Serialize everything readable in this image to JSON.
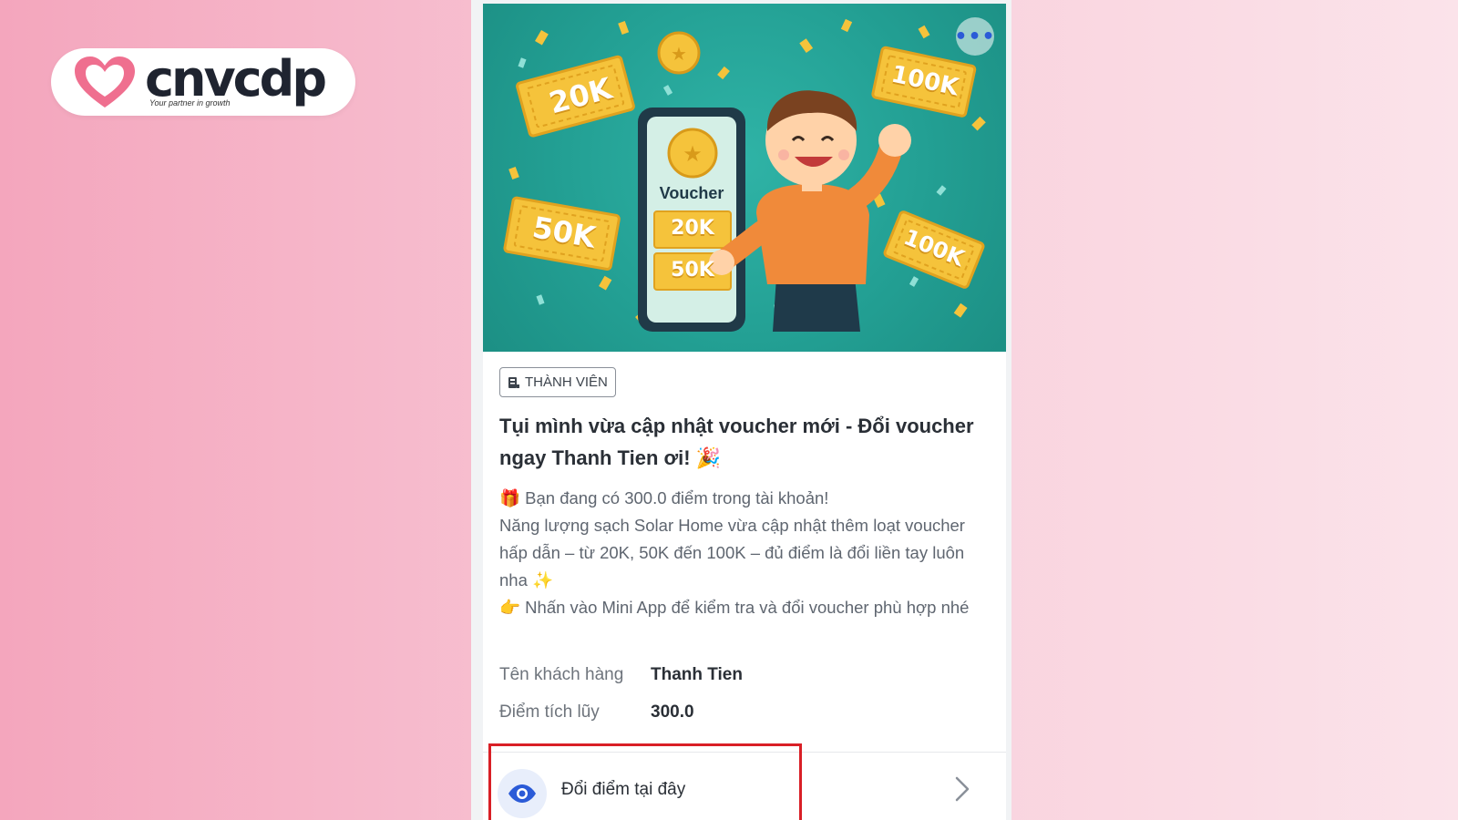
{
  "logo": {
    "wordmark": "cnvcdp",
    "tagline": "Your partner in growth"
  },
  "hero": {
    "tickets": [
      "20K",
      "50K",
      "100K",
      "100K"
    ],
    "phone_title": "Voucher",
    "phone_tickets": [
      "20K",
      "50K"
    ],
    "more_icon": "more-dots-icon"
  },
  "card": {
    "badge": "THÀNH VIÊN",
    "title": "Tụi mình vừa cập nhật voucher mới - Đổi voucher ngay Thanh Tien ơi! 🎉",
    "body_lines": [
      "🎁 Bạn đang có 300.0 điểm trong tài khoản!",
      "Năng lượng sạch Solar Home vừa cập nhật thêm loạt voucher hấp dẫn – từ 20K, 50K đến 100K – đủ điểm là đổi liền tay luôn nha ✨",
      "👉 Nhấn vào Mini App để kiểm tra và đổi voucher phù hợp nhé"
    ],
    "info": [
      {
        "label": "Tên khách hàng",
        "value": "Thanh Tien"
      },
      {
        "label": "Điểm tích lũy",
        "value": "300.0"
      }
    ],
    "action_label": "Đổi điểm tại đây"
  },
  "colors": {
    "accent_blue": "#2b5bd7",
    "highlight_red": "#d91f26",
    "hero_teal": "#23a094",
    "ticket_gold": "#f5c33b"
  }
}
